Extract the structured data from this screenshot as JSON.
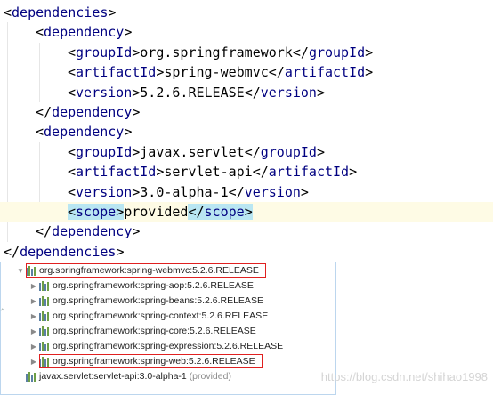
{
  "editor": {
    "lines": [
      {
        "indent": 0,
        "tag": "dependencies",
        "kind": "open"
      },
      {
        "indent": 1,
        "tag": "dependency",
        "kind": "open"
      },
      {
        "indent": 2,
        "tag": "groupId",
        "kind": "full",
        "text": "org.springframework"
      },
      {
        "indent": 2,
        "tag": "artifactId",
        "kind": "full",
        "text": "spring-webmvc"
      },
      {
        "indent": 2,
        "tag": "version",
        "kind": "full",
        "text": "5.2.6.RELEASE"
      },
      {
        "indent": 1,
        "tag": "dependency",
        "kind": "close"
      },
      {
        "indent": 1,
        "tag": "dependency",
        "kind": "open"
      },
      {
        "indent": 2,
        "tag": "groupId",
        "kind": "full",
        "text": "javax.servlet"
      },
      {
        "indent": 2,
        "tag": "artifactId",
        "kind": "full",
        "text": "servlet-api"
      },
      {
        "indent": 2,
        "tag": "version",
        "kind": "full",
        "text": "3.0-alpha-1"
      },
      {
        "indent": 2,
        "tag": "scope",
        "kind": "full",
        "text": "provided",
        "highlighted": true
      },
      {
        "indent": 1,
        "tag": "dependency",
        "kind": "close"
      },
      {
        "indent": 0,
        "tag": "dependencies",
        "kind": "close"
      }
    ]
  },
  "tree": {
    "nodes": [
      {
        "level": 0,
        "expanded": true,
        "label": "org.springframework:spring-webmvc:5.2.6.RELEASE",
        "boxed": true
      },
      {
        "level": 1,
        "expanded": false,
        "label": "org.springframework:spring-aop:5.2.6.RELEASE"
      },
      {
        "level": 1,
        "expanded": false,
        "label": "org.springframework:spring-beans:5.2.6.RELEASE"
      },
      {
        "level": 1,
        "expanded": false,
        "label": "org.springframework:spring-context:5.2.6.RELEASE"
      },
      {
        "level": 1,
        "expanded": false,
        "label": "org.springframework:spring-core:5.2.6.RELEASE"
      },
      {
        "level": 1,
        "expanded": false,
        "label": "org.springframework:spring-expression:5.2.6.RELEASE"
      },
      {
        "level": 1,
        "expanded": false,
        "label": "org.springframework:spring-web:5.2.6.RELEASE",
        "boxed": true
      },
      {
        "level": 0,
        "expanded": null,
        "label": "javax.servlet:servlet-api:3.0-alpha-1",
        "suffix": "(provided)"
      }
    ]
  },
  "watermark": "https://blog.csdn.net/shihao1998",
  "colors": {
    "tag": "#000080",
    "current_line": "#fefbe5",
    "tag_match": "#b9e6f2",
    "highlight_box": "#e02020",
    "tree_border": "#bcd6ee"
  }
}
